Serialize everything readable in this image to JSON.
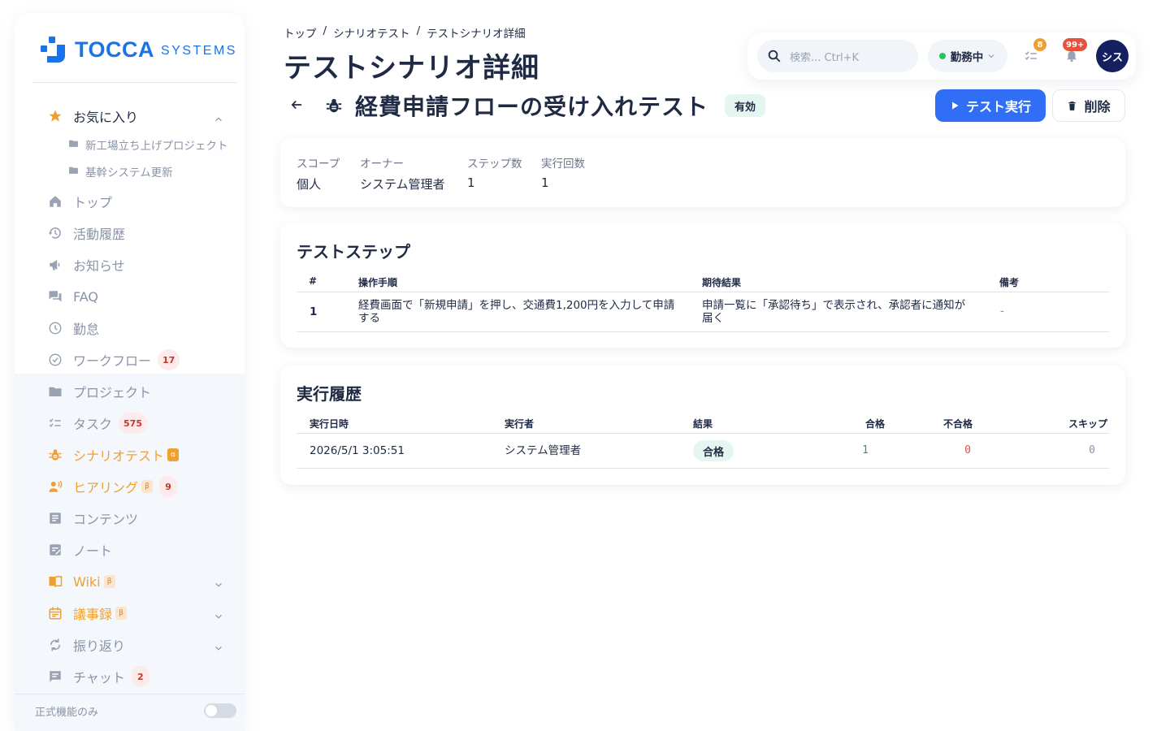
{
  "brand": {
    "name": "TOCCA",
    "sub": "SYSTEMS",
    "color": "#1a73e8"
  },
  "sidebar": {
    "favorites": {
      "label": "お気に入り",
      "items": [
        "新工場立ち上げプロジェクト",
        "基幹システム更新"
      ]
    },
    "items": [
      {
        "label": "トップ",
        "icon": "home-icon"
      },
      {
        "label": "活動履歴",
        "icon": "history-icon"
      },
      {
        "label": "お知らせ",
        "icon": "megaphone-icon"
      },
      {
        "label": "FAQ",
        "icon": "chat-bubbles-icon"
      },
      {
        "label": "勤怠",
        "icon": "clock-icon"
      },
      {
        "label": "ワークフロー",
        "icon": "check-circle-icon",
        "badge": "17"
      },
      {
        "label": "プロジェクト",
        "icon": "folder-icon"
      },
      {
        "label": "タスク",
        "icon": "checklist-icon",
        "badge": "575"
      },
      {
        "label": "シナリオテスト",
        "icon": "bug-icon",
        "tag": "α"
      },
      {
        "label": "ヒアリング",
        "icon": "voice-icon",
        "tag": "β",
        "badge": "9"
      },
      {
        "label": "コンテンツ",
        "icon": "article-icon"
      },
      {
        "label": "ノート",
        "icon": "note-icon"
      },
      {
        "label": "Wiki",
        "icon": "book-icon",
        "tag": "β"
      },
      {
        "label": "議事録",
        "icon": "calendar-icon",
        "tag": "β"
      },
      {
        "label": "振り返り",
        "icon": "sync-icon"
      },
      {
        "label": "チャット",
        "icon": "chat-icon",
        "badge": "2"
      }
    ],
    "footer_label": "正式機能のみ"
  },
  "header": {
    "breadcrumb": [
      "トップ",
      "/",
      "シナリオテスト",
      "/",
      "テストシナリオ詳細"
    ],
    "title": "テストシナリオ詳細"
  },
  "topbar": {
    "search_placeholder": "検索... Ctrl+K",
    "status": "勤務中",
    "task_badge": "8",
    "notif_badge": "99+",
    "avatar": "シス"
  },
  "scenario": {
    "title": "経費申請フローの受け入れテスト",
    "status": "有効",
    "run_label": "テスト実行",
    "delete_label": "削除",
    "accent": "#2f6ef5"
  },
  "meta": [
    {
      "label": "スコープ",
      "value": "個人"
    },
    {
      "label": "オーナー",
      "value": "システム管理者"
    },
    {
      "label": "ステップ数",
      "value": "1"
    },
    {
      "label": "実行回数",
      "value": "1"
    }
  ],
  "steps": {
    "title": "テストステップ",
    "columns": [
      "#",
      "操作手順",
      "期待結果",
      "備考"
    ],
    "rows": [
      {
        "no": "1",
        "action_l1": "経費画面で「新規申請」を押し、交通費1,200円を入力して申請",
        "action_l2": "する",
        "expected_l1": "申請一覧に「承認待ち」で表示され、承認者に通知が",
        "expected_l2": "届く",
        "note": "-"
      }
    ]
  },
  "history": {
    "title": "実行履歴",
    "columns": [
      "実行日時",
      "実行者",
      "結果",
      "合格",
      "不合格",
      "スキップ"
    ],
    "rows": [
      {
        "datetime": "2026/5/1 3:05:51",
        "executor": "システム管理者",
        "result": "合格",
        "pass": "1",
        "fail": "0",
        "skip": "0"
      }
    ]
  }
}
